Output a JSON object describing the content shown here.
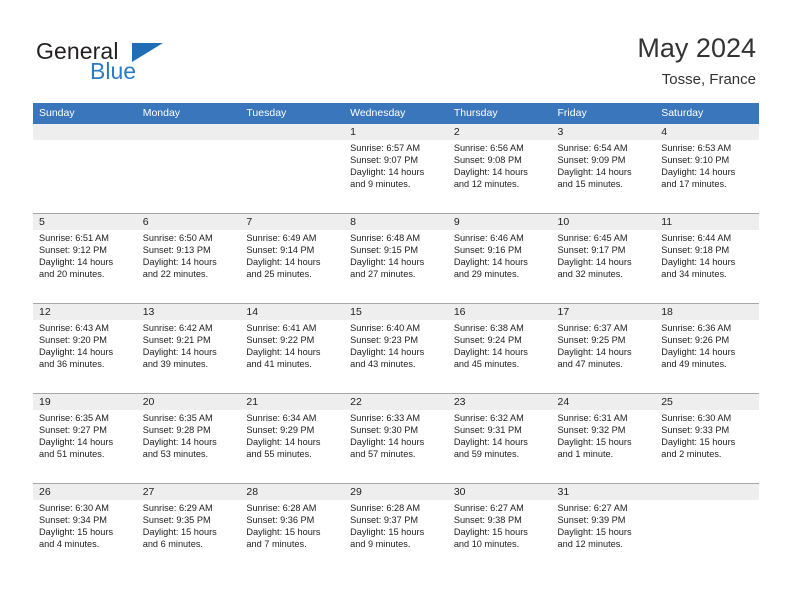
{
  "brand": {
    "name_part1": "General",
    "name_part2": "Blue",
    "triangle_color": "#1f6eb5",
    "blue_text_color": "#2b7cc3"
  },
  "header": {
    "title": "May 2024",
    "location": "Tosse, France",
    "weekday_bar_color": "#3a76bc",
    "weekday_text_color": "#ffffff",
    "date_band_color": "#eeeeee"
  },
  "weekdays": [
    "Sunday",
    "Monday",
    "Tuesday",
    "Wednesday",
    "Thursday",
    "Friday",
    "Saturday"
  ],
  "weeks": [
    {
      "days": [
        {
          "num": "",
          "lines": []
        },
        {
          "num": "",
          "lines": []
        },
        {
          "num": "",
          "lines": []
        },
        {
          "num": "1",
          "lines": [
            "Sunrise: 6:57 AM",
            "Sunset: 9:07 PM",
            "Daylight: 14 hours",
            "and 9 minutes."
          ]
        },
        {
          "num": "2",
          "lines": [
            "Sunrise: 6:56 AM",
            "Sunset: 9:08 PM",
            "Daylight: 14 hours",
            "and 12 minutes."
          ]
        },
        {
          "num": "3",
          "lines": [
            "Sunrise: 6:54 AM",
            "Sunset: 9:09 PM",
            "Daylight: 14 hours",
            "and 15 minutes."
          ]
        },
        {
          "num": "4",
          "lines": [
            "Sunrise: 6:53 AM",
            "Sunset: 9:10 PM",
            "Daylight: 14 hours",
            "and 17 minutes."
          ]
        }
      ]
    },
    {
      "days": [
        {
          "num": "5",
          "lines": [
            "Sunrise: 6:51 AM",
            "Sunset: 9:12 PM",
            "Daylight: 14 hours",
            "and 20 minutes."
          ]
        },
        {
          "num": "6",
          "lines": [
            "Sunrise: 6:50 AM",
            "Sunset: 9:13 PM",
            "Daylight: 14 hours",
            "and 22 minutes."
          ]
        },
        {
          "num": "7",
          "lines": [
            "Sunrise: 6:49 AM",
            "Sunset: 9:14 PM",
            "Daylight: 14 hours",
            "and 25 minutes."
          ]
        },
        {
          "num": "8",
          "lines": [
            "Sunrise: 6:48 AM",
            "Sunset: 9:15 PM",
            "Daylight: 14 hours",
            "and 27 minutes."
          ]
        },
        {
          "num": "9",
          "lines": [
            "Sunrise: 6:46 AM",
            "Sunset: 9:16 PM",
            "Daylight: 14 hours",
            "and 29 minutes."
          ]
        },
        {
          "num": "10",
          "lines": [
            "Sunrise: 6:45 AM",
            "Sunset: 9:17 PM",
            "Daylight: 14 hours",
            "and 32 minutes."
          ]
        },
        {
          "num": "11",
          "lines": [
            "Sunrise: 6:44 AM",
            "Sunset: 9:18 PM",
            "Daylight: 14 hours",
            "and 34 minutes."
          ]
        }
      ]
    },
    {
      "days": [
        {
          "num": "12",
          "lines": [
            "Sunrise: 6:43 AM",
            "Sunset: 9:20 PM",
            "Daylight: 14 hours",
            "and 36 minutes."
          ]
        },
        {
          "num": "13",
          "lines": [
            "Sunrise: 6:42 AM",
            "Sunset: 9:21 PM",
            "Daylight: 14 hours",
            "and 39 minutes."
          ]
        },
        {
          "num": "14",
          "lines": [
            "Sunrise: 6:41 AM",
            "Sunset: 9:22 PM",
            "Daylight: 14 hours",
            "and 41 minutes."
          ]
        },
        {
          "num": "15",
          "lines": [
            "Sunrise: 6:40 AM",
            "Sunset: 9:23 PM",
            "Daylight: 14 hours",
            "and 43 minutes."
          ]
        },
        {
          "num": "16",
          "lines": [
            "Sunrise: 6:38 AM",
            "Sunset: 9:24 PM",
            "Daylight: 14 hours",
            "and 45 minutes."
          ]
        },
        {
          "num": "17",
          "lines": [
            "Sunrise: 6:37 AM",
            "Sunset: 9:25 PM",
            "Daylight: 14 hours",
            "and 47 minutes."
          ]
        },
        {
          "num": "18",
          "lines": [
            "Sunrise: 6:36 AM",
            "Sunset: 9:26 PM",
            "Daylight: 14 hours",
            "and 49 minutes."
          ]
        }
      ]
    },
    {
      "days": [
        {
          "num": "19",
          "lines": [
            "Sunrise: 6:35 AM",
            "Sunset: 9:27 PM",
            "Daylight: 14 hours",
            "and 51 minutes."
          ]
        },
        {
          "num": "20",
          "lines": [
            "Sunrise: 6:35 AM",
            "Sunset: 9:28 PM",
            "Daylight: 14 hours",
            "and 53 minutes."
          ]
        },
        {
          "num": "21",
          "lines": [
            "Sunrise: 6:34 AM",
            "Sunset: 9:29 PM",
            "Daylight: 14 hours",
            "and 55 minutes."
          ]
        },
        {
          "num": "22",
          "lines": [
            "Sunrise: 6:33 AM",
            "Sunset: 9:30 PM",
            "Daylight: 14 hours",
            "and 57 minutes."
          ]
        },
        {
          "num": "23",
          "lines": [
            "Sunrise: 6:32 AM",
            "Sunset: 9:31 PM",
            "Daylight: 14 hours",
            "and 59 minutes."
          ]
        },
        {
          "num": "24",
          "lines": [
            "Sunrise: 6:31 AM",
            "Sunset: 9:32 PM",
            "Daylight: 15 hours",
            "and 1 minute."
          ]
        },
        {
          "num": "25",
          "lines": [
            "Sunrise: 6:30 AM",
            "Sunset: 9:33 PM",
            "Daylight: 15 hours",
            "and 2 minutes."
          ]
        }
      ]
    },
    {
      "days": [
        {
          "num": "26",
          "lines": [
            "Sunrise: 6:30 AM",
            "Sunset: 9:34 PM",
            "Daylight: 15 hours",
            "and 4 minutes."
          ]
        },
        {
          "num": "27",
          "lines": [
            "Sunrise: 6:29 AM",
            "Sunset: 9:35 PM",
            "Daylight: 15 hours",
            "and 6 minutes."
          ]
        },
        {
          "num": "28",
          "lines": [
            "Sunrise: 6:28 AM",
            "Sunset: 9:36 PM",
            "Daylight: 15 hours",
            "and 7 minutes."
          ]
        },
        {
          "num": "29",
          "lines": [
            "Sunrise: 6:28 AM",
            "Sunset: 9:37 PM",
            "Daylight: 15 hours",
            "and 9 minutes."
          ]
        },
        {
          "num": "30",
          "lines": [
            "Sunrise: 6:27 AM",
            "Sunset: 9:38 PM",
            "Daylight: 15 hours",
            "and 10 minutes."
          ]
        },
        {
          "num": "31",
          "lines": [
            "Sunrise: 6:27 AM",
            "Sunset: 9:39 PM",
            "Daylight: 15 hours",
            "and 12 minutes."
          ]
        },
        {
          "num": "",
          "lines": []
        }
      ]
    }
  ]
}
